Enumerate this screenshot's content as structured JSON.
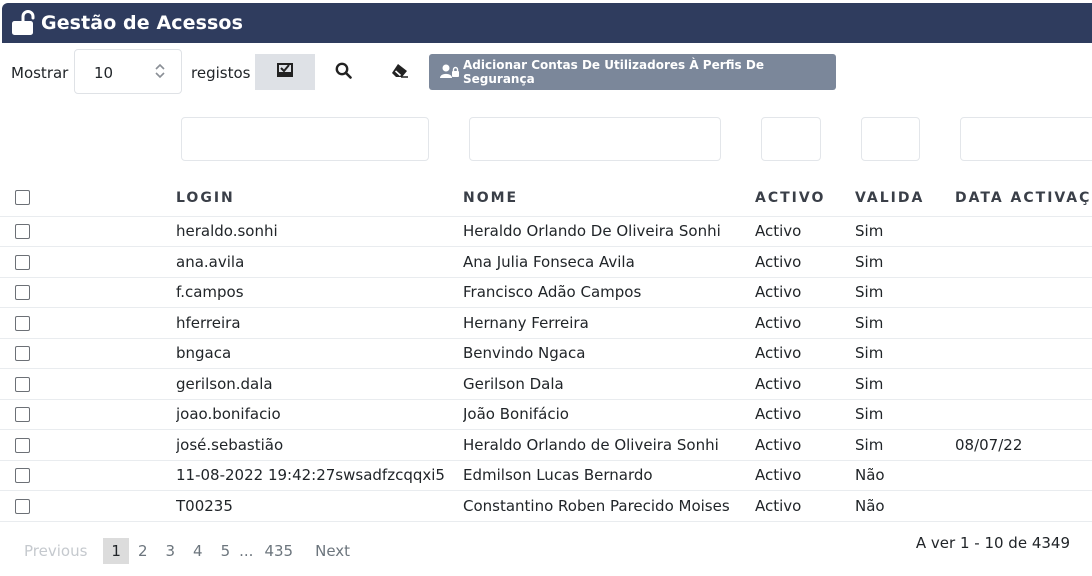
{
  "header": {
    "title": "Gestão de Acessos",
    "icon": "unlock-icon",
    "bg_color": "#2f3c5e"
  },
  "toolbar": {
    "show_label": "Mostrar",
    "page_size": "10",
    "records_label": "registos",
    "add_button_label": "Adicionar Contas De Utilizadores À Perfis De Segurança",
    "add_button_color": "#7b879a"
  },
  "table": {
    "columns": [
      "LOGIN",
      "NOME",
      "ACTIVO",
      "VALIDA",
      "DATA ACTIVAÇ"
    ],
    "rows": [
      [
        "heraldo.sonhi",
        "Heraldo Orlando De Oliveira Sonhi",
        "Activo",
        "Sim",
        ""
      ],
      [
        "ana.avila",
        "Ana Julia Fonseca Avila",
        "Activo",
        "Sim",
        ""
      ],
      [
        "f.campos",
        "Francisco Adão Campos",
        "Activo",
        "Sim",
        ""
      ],
      [
        "hferreira",
        "Hernany Ferreira",
        "Activo",
        "Sim",
        ""
      ],
      [
        "bngaca",
        "Benvindo Ngaca",
        "Activo",
        "Sim",
        ""
      ],
      [
        "gerilson.dala",
        "Gerilson Dala",
        "Activo",
        "Sim",
        ""
      ],
      [
        "joao.bonifacio",
        "João Bonifácio",
        "Activo",
        "Sim",
        ""
      ],
      [
        "josé.sebastião",
        "Heraldo Orlando de Oliveira Sonhi",
        "Activo",
        "Sim",
        "08/07/22"
      ],
      [
        "11-08-2022 19:42:27swsadfzcqqxi5",
        "Edmilson Lucas Bernardo",
        "Activo",
        "Não",
        ""
      ],
      [
        "T00235",
        "Constantino Roben Parecido Moises",
        "Activo",
        "Não",
        ""
      ]
    ]
  },
  "pagination": {
    "previous": "Previous",
    "pages": [
      "1",
      "2",
      "3",
      "4",
      "5"
    ],
    "ellipsis": "...",
    "last": "435",
    "next": "Next",
    "current": "1",
    "info": "A ver 1 - 10 de 4349"
  }
}
